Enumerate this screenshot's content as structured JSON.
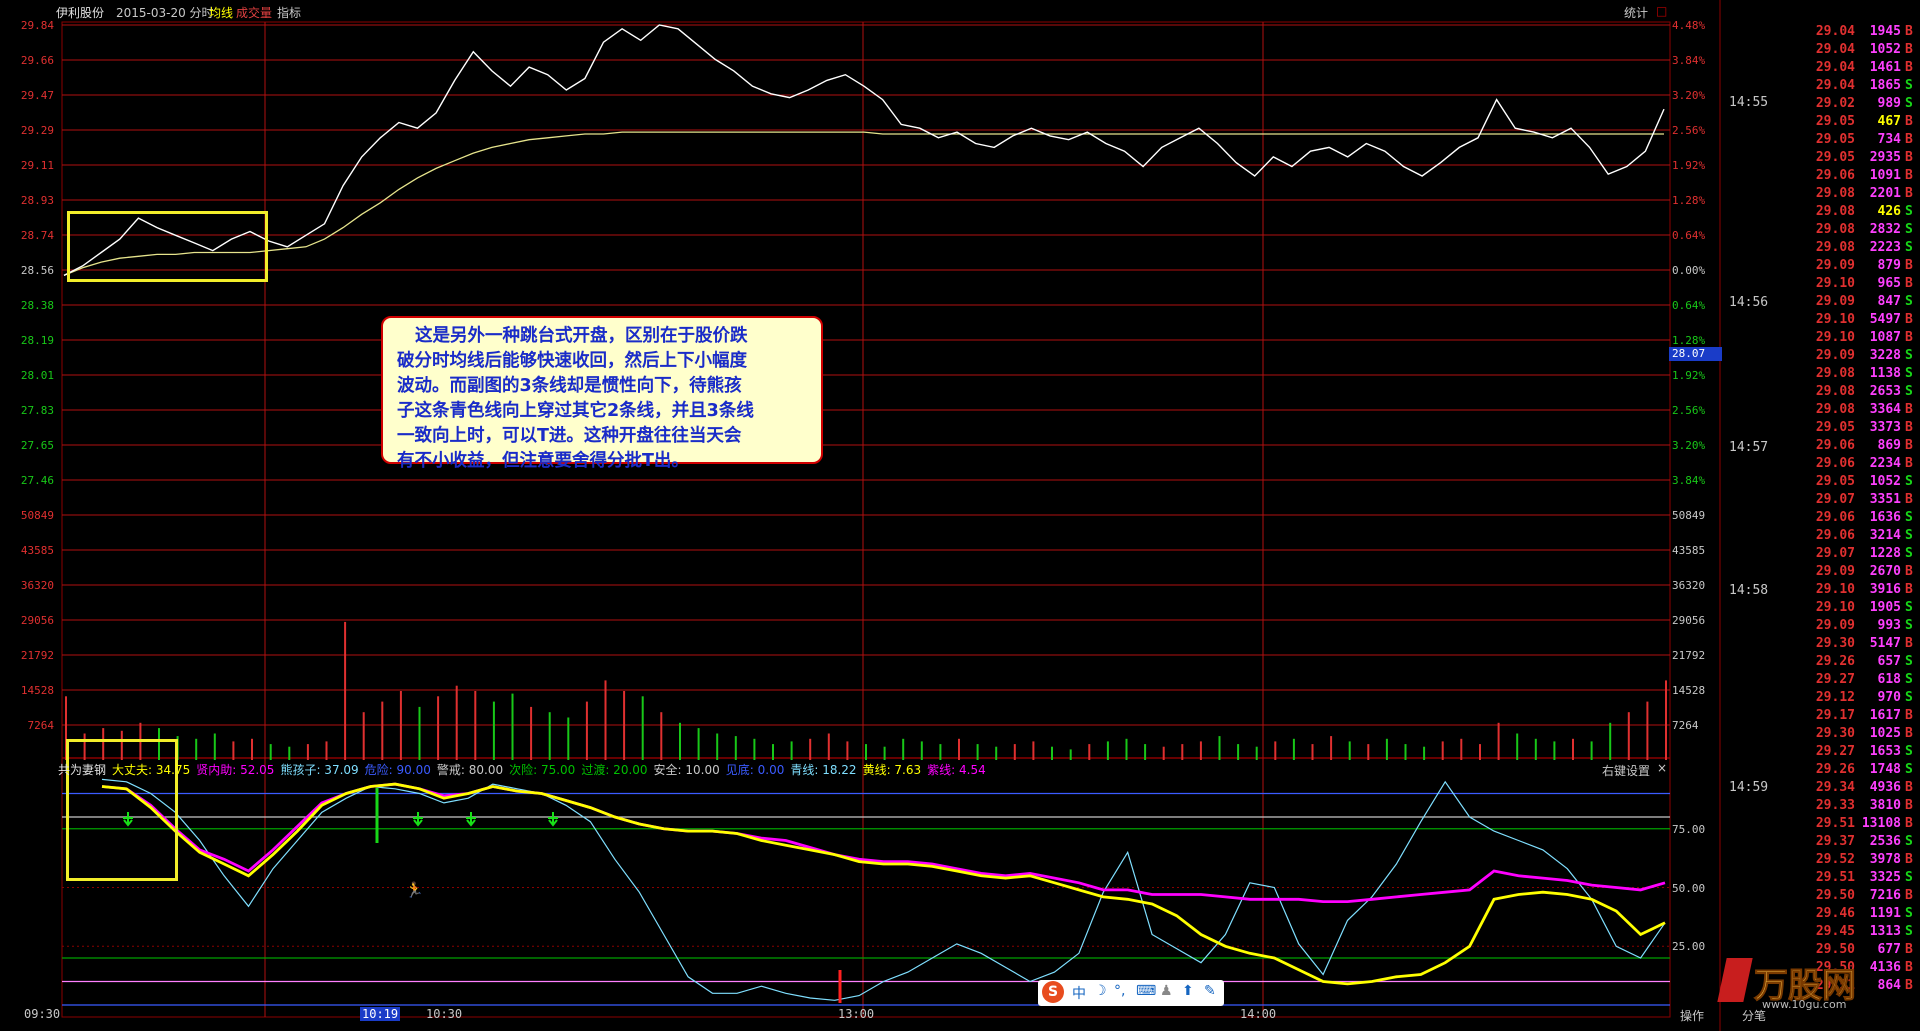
{
  "header": {
    "stock_name": "伊利股份",
    "date_mode": "2015-03-20 分时",
    "avg_line": "均线",
    "volume": "成交量",
    "indicator": "指标",
    "stats": "统计",
    "close": "□"
  },
  "price_axis": [
    "29.84",
    "29.66",
    "29.47",
    "29.29",
    "29.11",
    "28.93",
    "28.74",
    "28.56",
    "28.38",
    "28.19",
    "28.01",
    "27.83",
    "27.65",
    "27.46"
  ],
  "pct_axis": [
    "4.48%",
    "3.84%",
    "3.20%",
    "2.56%",
    "1.92%",
    "1.28%",
    "0.64%",
    "0.00%",
    "0.64%",
    "1.28%",
    "1.92%",
    "2.56%",
    "3.20%",
    "3.84%"
  ],
  "price_marker": "28.07",
  "volume_axis": [
    "50849",
    "43585",
    "36320",
    "29056",
    "21792",
    "14528",
    "7264"
  ],
  "indicator_axis": [
    "75.00",
    "50.00",
    "25.00"
  ],
  "indicator_header": {
    "name": "共为妻钢",
    "items": [
      {
        "label": "大丈夫:",
        "value": "34.75",
        "color": "#ffff00"
      },
      {
        "label": "贤内助:",
        "value": "52.05",
        "color": "#ff00ff"
      },
      {
        "label": "熊孩子:",
        "value": "37.09",
        "color": "#7fdfff"
      },
      {
        "label": "危险:",
        "value": "90.00",
        "color": "#3b5bff"
      },
      {
        "label": "警戒:",
        "value": "80.00",
        "color": "#c8c8c8"
      },
      {
        "label": "次险:",
        "value": "75.00",
        "color": "#00c000"
      },
      {
        "label": "过渡:",
        "value": "20.00",
        "color": "#00c000"
      },
      {
        "label": "安全:",
        "value": "10.00",
        "color": "#c8c8c8"
      },
      {
        "label": "见底:",
        "value": "0.00",
        "color": "#3b5bff"
      },
      {
        "label": "青线:",
        "value": "18.22",
        "color": "#7fdfff"
      },
      {
        "label": "黄线:",
        "value": "7.63",
        "color": "#ffff00"
      },
      {
        "label": "紫线:",
        "value": "4.54",
        "color": "#ff00ff"
      }
    ],
    "settings": "右键设置",
    "close": "×"
  },
  "time_axis": [
    "09:30",
    "10:19",
    "10:30",
    "13:00",
    "14:00"
  ],
  "callout_lines": [
    "这是另外一种跳台式开盘，区别在于股价跌",
    "破分时均线后能够快速收回，然后上下小幅度",
    "波动。而副图的3条线却是惯性向下，待熊孩",
    "子这条青色线向上穿过其它2条线，并且3条线",
    "一致向上时，可以T进。这种开盘往往当天会",
    "有不小收益，但注意要舍得分批T出。"
  ],
  "ime_toolbar": [
    "S",
    "中",
    "☽",
    "°,",
    "⌨",
    "♟",
    "⬆",
    "✎"
  ],
  "footer": {
    "ops": "操作",
    "split": "分笔",
    "watermark": "万股网",
    "url": "www.10gu.com"
  },
  "tick_times": [
    "14:55",
    "14:56",
    "14:57",
    "14:58",
    "14:59"
  ],
  "ticks": [
    [
      "29.04",
      "1945",
      "B"
    ],
    [
      "29.04",
      "1052",
      "B"
    ],
    [
      "29.04",
      "1461",
      "B"
    ],
    [
      "29.04",
      "1865",
      "S"
    ],
    [
      "29.02",
      "989",
      "S"
    ],
    [
      "29.05",
      "467",
      "B"
    ],
    [
      "29.05",
      "734",
      "B"
    ],
    [
      "29.05",
      "2935",
      "B"
    ],
    [
      "29.06",
      "1091",
      "B"
    ],
    [
      "29.08",
      "2201",
      "B"
    ],
    [
      "29.08",
      "426",
      "S"
    ],
    [
      "29.08",
      "2832",
      "S"
    ],
    [
      "29.08",
      "2223",
      "S"
    ],
    [
      "29.09",
      "879",
      "B"
    ],
    [
      "29.10",
      "965",
      "B"
    ],
    [
      "29.09",
      "847",
      "S"
    ],
    [
      "29.10",
      "5497",
      "B"
    ],
    [
      "29.10",
      "1087",
      "B"
    ],
    [
      "29.09",
      "3228",
      "S"
    ],
    [
      "29.08",
      "1138",
      "S"
    ],
    [
      "29.08",
      "2653",
      "S"
    ],
    [
      "29.08",
      "3364",
      "B"
    ],
    [
      "29.05",
      "3373",
      "B"
    ],
    [
      "29.06",
      "869",
      "B"
    ],
    [
      "29.06",
      "2234",
      "B"
    ],
    [
      "29.05",
      "1052",
      "S"
    ],
    [
      "29.07",
      "3351",
      "B"
    ],
    [
      "29.06",
      "1636",
      "S"
    ],
    [
      "29.06",
      "3214",
      "S"
    ],
    [
      "29.07",
      "1228",
      "S"
    ],
    [
      "29.09",
      "2670",
      "B"
    ],
    [
      "29.10",
      "3916",
      "B"
    ],
    [
      "29.10",
      "1905",
      "S"
    ],
    [
      "29.09",
      "993",
      "S"
    ],
    [
      "29.30",
      "5147",
      "B"
    ],
    [
      "29.26",
      "657",
      "S"
    ],
    [
      "29.27",
      "618",
      "S"
    ],
    [
      "29.12",
      "970",
      "S"
    ],
    [
      "29.17",
      "1617",
      "B"
    ],
    [
      "29.30",
      "1025",
      "B"
    ],
    [
      "29.27",
      "1653",
      "S"
    ],
    [
      "29.26",
      "1748",
      "S"
    ],
    [
      "29.34",
      "4936",
      "B"
    ],
    [
      "29.33",
      "3810",
      "B"
    ],
    [
      "29.51",
      "13108",
      "B"
    ],
    [
      "29.37",
      "2536",
      "S"
    ],
    [
      "29.52",
      "3978",
      "B"
    ],
    [
      "29.51",
      "3325",
      "S"
    ],
    [
      "29.50",
      "7216",
      "B"
    ],
    [
      "29.46",
      "1191",
      "S"
    ],
    [
      "29.45",
      "1313",
      "S"
    ],
    [
      "29.50",
      "677",
      "B"
    ],
    [
      "29.50",
      "4136",
      "B"
    ],
    [
      "29.51",
      "864",
      "B"
    ]
  ],
  "chart_data": {
    "type": "line",
    "symbol": "伊利股份",
    "date": "2015-03-20",
    "ylim_price": [
      27.46,
      29.84
    ],
    "reference_price": 28.56,
    "price": [
      28.53,
      28.58,
      28.65,
      28.72,
      28.83,
      28.78,
      28.74,
      28.7,
      28.66,
      28.72,
      28.76,
      28.71,
      28.68,
      28.74,
      28.8,
      29.0,
      29.15,
      29.25,
      29.33,
      29.3,
      29.38,
      29.55,
      29.7,
      29.6,
      29.52,
      29.62,
      29.58,
      29.5,
      29.56,
      29.75,
      29.82,
      29.76,
      29.84,
      29.82,
      29.74,
      29.66,
      29.6,
      29.52,
      29.48,
      29.46,
      29.5,
      29.55,
      29.58,
      29.52,
      29.45,
      29.32,
      29.3,
      29.25,
      29.28,
      29.22,
      29.2,
      29.26,
      29.3,
      29.26,
      29.24,
      29.28,
      29.22,
      29.18,
      29.1,
      29.2,
      29.25,
      29.3,
      29.22,
      29.12,
      29.05,
      29.15,
      29.1,
      29.18,
      29.2,
      29.15,
      29.22,
      29.18,
      29.1,
      29.05,
      29.12,
      29.2,
      29.25,
      29.45,
      29.3,
      29.28,
      29.25,
      29.3,
      29.2,
      29.06,
      29.1,
      29.18,
      29.4
    ],
    "avg": [
      28.53,
      28.57,
      28.6,
      28.62,
      28.63,
      28.64,
      28.64,
      28.65,
      28.65,
      28.65,
      28.65,
      28.66,
      28.67,
      28.68,
      28.72,
      28.78,
      28.85,
      28.91,
      28.98,
      29.04,
      29.09,
      29.13,
      29.17,
      29.2,
      29.22,
      29.24,
      29.25,
      29.26,
      29.27,
      29.27,
      29.28,
      29.28,
      29.28,
      29.28,
      29.28,
      29.28,
      29.28,
      29.28,
      29.28,
      29.28,
      29.28,
      29.28,
      29.28,
      29.28,
      29.27,
      29.27,
      29.27,
      29.27,
      29.27,
      29.27,
      29.27,
      29.27,
      29.27,
      29.27,
      29.27,
      29.27,
      29.27,
      29.27,
      29.27,
      29.27,
      29.27,
      29.27,
      29.27,
      29.27,
      29.27,
      29.27,
      29.27,
      29.27,
      29.27,
      29.27,
      29.27,
      29.27,
      29.27,
      29.27,
      29.27,
      29.27,
      29.27,
      29.27,
      29.27,
      29.27,
      29.27,
      29.27,
      29.27,
      29.27,
      29.27,
      29.27,
      29.27
    ],
    "volume_max": 50849,
    "volume": [
      12000,
      5000,
      6000,
      5500,
      7000,
      6000,
      4500,
      4000,
      5000,
      3500,
      4000,
      3000,
      2500,
      3000,
      3500,
      26000,
      9000,
      11000,
      13000,
      10000,
      12000,
      14000,
      13000,
      11000,
      12500,
      10000,
      9000,
      8000,
      11000,
      15000,
      13000,
      12000,
      9000,
      7000,
      6000,
      5000,
      4500,
      4000,
      3000,
      3500,
      4000,
      5000,
      3500,
      3000,
      2500,
      4000,
      3500,
      3000,
      4000,
      3000,
      2500,
      3000,
      3500,
      2500,
      2000,
      3000,
      3500,
      4000,
      3000,
      2500,
      3000,
      3500,
      4500,
      3000,
      2500,
      3500,
      4000,
      3000,
      4500,
      3500,
      3000,
      4000,
      3000,
      2500,
      3500,
      4000,
      3000,
      7000,
      5000,
      4000,
      3500,
      4000,
      3500,
      7000,
      9000,
      11000,
      15000
    ],
    "indicator_ylim": [
      0,
      100
    ],
    "series": [
      {
        "name": "熊孩子",
        "color": "#7fdfff",
        "values": [
          96,
          95,
          90,
          82,
          70,
          55,
          42,
          58,
          70,
          82,
          88,
          93,
          92,
          90,
          86,
          88,
          94,
          92,
          90,
          85,
          78,
          62,
          48,
          30,
          12,
          5,
          5,
          8,
          5,
          3,
          2,
          4,
          10,
          14,
          20,
          26,
          22,
          16,
          10,
          14,
          22,
          48,
          65,
          30,
          24,
          18,
          30,
          52,
          50,
          26,
          13,
          36,
          46,
          60,
          78,
          95,
          80,
          74,
          70,
          66,
          58,
          45,
          25,
          20,
          35
        ]
      },
      {
        "name": "贤内助",
        "color": "#ff00ff",
        "values": [
          93,
          92,
          85,
          75,
          66,
          62,
          57,
          66,
          76,
          86,
          90,
          93,
          94,
          92,
          89,
          90,
          93,
          91,
          90,
          87,
          84,
          80,
          77,
          75,
          74,
          74,
          73,
          71,
          70,
          67,
          64,
          62,
          61,
          61,
          60,
          58,
          56,
          55,
          56,
          54,
          52,
          49,
          49,
          47,
          47,
          47,
          46,
          45,
          45,
          45,
          44,
          44,
          45,
          46,
          47,
          48,
          49,
          57,
          55,
          54,
          53,
          51,
          50,
          49,
          52
        ]
      },
      {
        "name": "大丈夫",
        "color": "#ffff00",
        "values": [
          93,
          92,
          84,
          74,
          65,
          60,
          55,
          64,
          74,
          85,
          90,
          93,
          94,
          92,
          88,
          90,
          93,
          91,
          90,
          87,
          84,
          80,
          77,
          75,
          74,
          74,
          73,
          70,
          68,
          66,
          64,
          61,
          60,
          60,
          59,
          57,
          55,
          54,
          55,
          52,
          49,
          46,
          45,
          43,
          38,
          30,
          25,
          22,
          20,
          15,
          10,
          9,
          10,
          12,
          13,
          18,
          25,
          45,
          47,
          48,
          47,
          45,
          40,
          30,
          35
        ]
      }
    ]
  }
}
